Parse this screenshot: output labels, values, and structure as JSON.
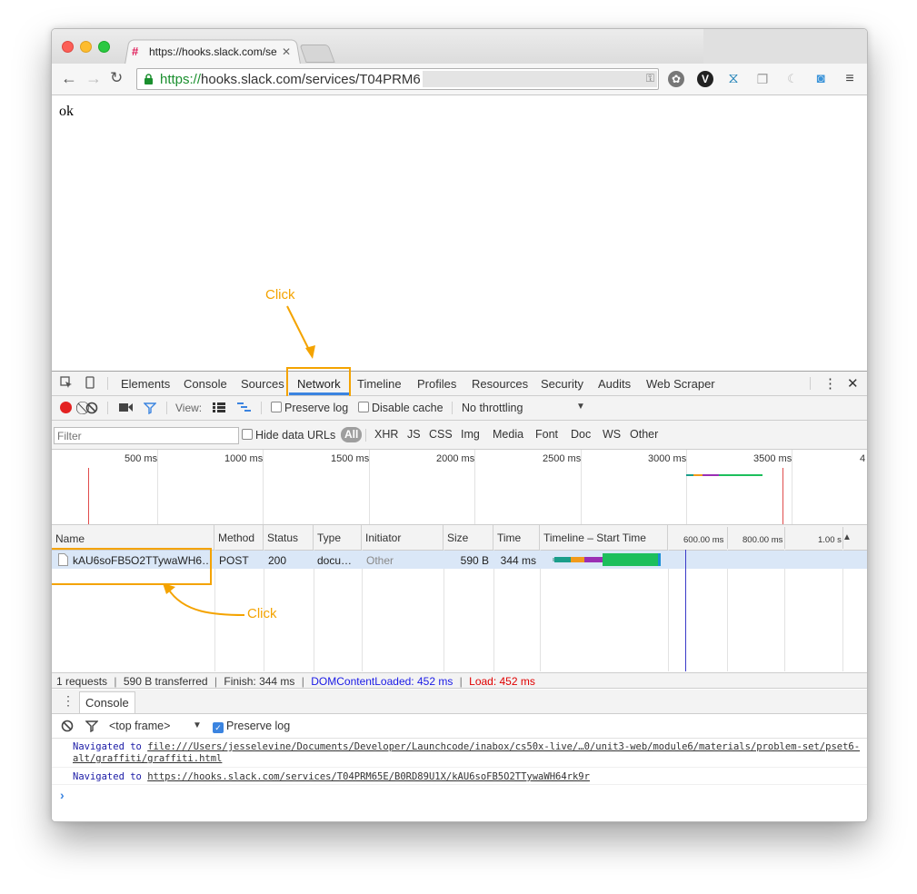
{
  "browser": {
    "tab_title": "https://hooks.slack.com/se",
    "tab_close": "✕",
    "url_scheme": "https://",
    "url_rest": "hooks.slack.com/services/T04PRM6"
  },
  "page": {
    "body_text": "ok"
  },
  "annotations": {
    "click_network": "Click",
    "click_request": "Click"
  },
  "devtools": {
    "tabs": [
      "Elements",
      "Console",
      "Sources",
      "Network",
      "Timeline",
      "Profiles",
      "Resources",
      "Security",
      "Audits",
      "Web Scraper"
    ],
    "active_tab": "Network",
    "close_glyph": "✕",
    "more_glyph": "⋮",
    "network_toolbar": {
      "view_label": "View:",
      "preserve_log": "Preserve log",
      "disable_cache": "Disable cache",
      "throttling": "No throttling"
    },
    "filter": {
      "placeholder": "Filter",
      "hide_data_urls": "Hide data URLs",
      "types": [
        "All",
        "XHR",
        "JS",
        "CSS",
        "Img",
        "Media",
        "Font",
        "Doc",
        "WS",
        "Other"
      ]
    },
    "overview_ticks": [
      "500 ms",
      "1000 ms",
      "1500 ms",
      "2000 ms",
      "2500 ms",
      "3000 ms",
      "3500 ms",
      "4"
    ],
    "grid": {
      "columns": [
        "Name",
        "Method",
        "Status",
        "Type",
        "Initiator",
        "Size",
        "Time",
        "Timeline – Start Time"
      ],
      "timeline_ticks": [
        "600.00 ms",
        "800.00 ms",
        "1.00 s"
      ],
      "row": {
        "name": "kAU6soFB5O2TTywaWH6…",
        "method": "POST",
        "status": "200",
        "type": "docu…",
        "initiator": "Other",
        "size": "590 B",
        "time": "344 ms"
      }
    },
    "status": {
      "requests": "1 requests",
      "transferred": "590 B transferred",
      "finish": "Finish: 344 ms",
      "dom_loaded": "DOMContentLoaded: 452 ms",
      "load": "Load: 452 ms",
      "sep": "|"
    },
    "drawer": {
      "tab": "Console",
      "frame": "<top frame>",
      "preserve_log": "Preserve log",
      "messages": [
        {
          "prefix": "Navigated to",
          "link": "file:///Users/jesselevine/Documents/Developer/Launchcode/inabox/cs50x-live/…0/unit3-web/module6/materials/problem-set/pset6-alt/graffiti/graffiti.html"
        },
        {
          "prefix": "Navigated to",
          "link": "https://hooks.slack.com/services/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"
        }
      ],
      "prompt": "›"
    }
  },
  "colors": {
    "annotation": "#f4a300",
    "dom_loaded": "#1a1ae6",
    "load": "#e00000",
    "url_green": "#1a8f2e"
  }
}
